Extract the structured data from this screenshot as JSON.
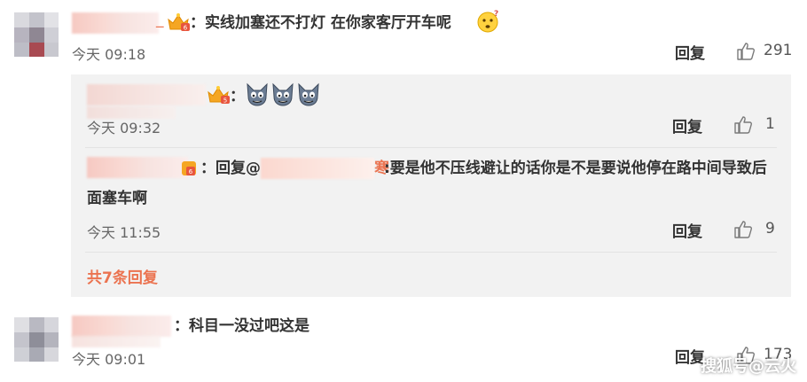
{
  "comments": [
    {
      "text": "：实线加塞还不打灯 在你家客厅开车呢",
      "time": "今天 09:18",
      "reply_label": "回复",
      "likes": "291"
    },
    {
      "text": "：科目一没过吧这是",
      "time": "今天 09:01",
      "reply_label": "回复",
      "likes": "173"
    }
  ],
  "replies": [
    {
      "text_suffix": "：",
      "time": "今天 09:32",
      "reply_label": "回复",
      "likes": "1"
    },
    {
      "prefix": "：回复@",
      "mention_tail": "寒",
      "text": ":要是他不压线避让的话你是不是要说他停在路中间导致后面塞车啊",
      "time": "今天 11:55",
      "reply_label": "回复",
      "likes": "9"
    }
  ],
  "more_replies": "共7条回复",
  "watermark": "搜狐号@云火",
  "icons": {
    "thumb": "thumbs-up-icon",
    "emoji": "thinking-face-emoji",
    "tom": "tom-cat-emoji",
    "crown": "vip-crown-badge"
  },
  "colors": {
    "accent": "#eb7350",
    "reply_bg": "#f2f2f2"
  }
}
